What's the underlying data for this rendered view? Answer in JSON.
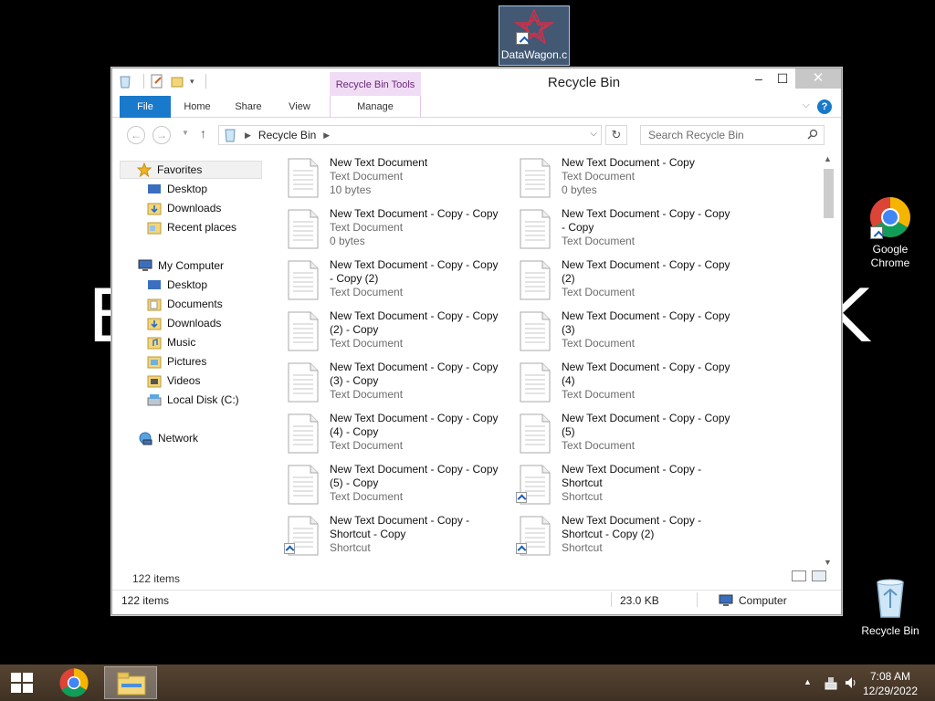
{
  "desktop": {
    "bg_text_left": "B",
    "bg_text_right": "K",
    "icons": [
      {
        "label": "DataWagon.c",
        "icon": "datawagon-icon"
      },
      {
        "label": "Google Chrome",
        "icon": "chrome-icon"
      },
      {
        "label": "Recycle Bin",
        "icon": "recycle-bin-icon"
      }
    ]
  },
  "window": {
    "title": "Recycle Bin",
    "context_tab": "Recycle Bin Tools",
    "ribbon_tabs": [
      "File",
      "Home",
      "Share",
      "View",
      "Manage"
    ],
    "help_label": "?",
    "address": {
      "root_label": "Recycle Bin"
    },
    "search": {
      "placeholder": "Search Recycle Bin"
    },
    "nav": {
      "favorites_label": "Favorites",
      "favorites": [
        "Desktop",
        "Downloads",
        "Recent places"
      ],
      "computer_label": "My Computer",
      "computer": [
        "Desktop",
        "Documents",
        "Downloads",
        "Music",
        "Pictures",
        "Videos",
        "Local Disk (C:)"
      ],
      "network_label": "Network"
    },
    "files": [
      {
        "line1": "New Text Document",
        "line2": "",
        "line3": "Text Document",
        "line4": "10 bytes",
        "shortcut": false
      },
      {
        "line1": "New Text Document - Copy",
        "line2": "",
        "line3": "Text Document",
        "line4": "0 bytes",
        "shortcut": false
      },
      {
        "line1": "New Text Document - Copy - Copy",
        "line2": "",
        "line3": "Text Document",
        "line4": "0 bytes",
        "shortcut": false
      },
      {
        "line1": "New Text Document - Copy - Copy",
        "line2": "- Copy",
        "line3": "Text Document",
        "line4": "",
        "shortcut": false
      },
      {
        "line1": "New Text Document - Copy - Copy",
        "line2": "- Copy (2)",
        "line3": "Text Document",
        "line4": "",
        "shortcut": false
      },
      {
        "line1": "New Text Document - Copy - Copy",
        "line2": "(2)",
        "line3": "Text Document",
        "line4": "",
        "shortcut": false
      },
      {
        "line1": "New Text Document - Copy - Copy",
        "line2": "(2) - Copy",
        "line3": "Text Document",
        "line4": "",
        "shortcut": false
      },
      {
        "line1": "New Text Document - Copy - Copy",
        "line2": "(3)",
        "line3": "Text Document",
        "line4": "",
        "shortcut": false
      },
      {
        "line1": "New Text Document - Copy - Copy",
        "line2": "(3) - Copy",
        "line3": "Text Document",
        "line4": "",
        "shortcut": false
      },
      {
        "line1": "New Text Document - Copy - Copy",
        "line2": "(4)",
        "line3": "Text Document",
        "line4": "",
        "shortcut": false
      },
      {
        "line1": "New Text Document - Copy - Copy",
        "line2": "(4) - Copy",
        "line3": "Text Document",
        "line4": "",
        "shortcut": false
      },
      {
        "line1": "New Text Document - Copy - Copy",
        "line2": "(5)",
        "line3": "Text Document",
        "line4": "",
        "shortcut": false
      },
      {
        "line1": "New Text Document - Copy - Copy",
        "line2": "(5) - Copy",
        "line3": "Text Document",
        "line4": "",
        "shortcut": false
      },
      {
        "line1": "New Text Document - Copy -",
        "line2": "Shortcut",
        "line3": "Shortcut",
        "line4": "",
        "shortcut": true
      },
      {
        "line1": "New Text Document - Copy -",
        "line2": "Shortcut - Copy",
        "line3": "Shortcut",
        "line4": "",
        "shortcut": true
      },
      {
        "line1": "New Text Document - Copy -",
        "line2": "Shortcut - Copy (2)",
        "line3": "Shortcut",
        "line4": "",
        "shortcut": true
      }
    ],
    "item_count": "122 items",
    "status": {
      "items": "122 items",
      "size": "23.0 KB",
      "location": "Computer"
    }
  },
  "taskbar": {
    "time": "7:08 AM",
    "date": "12/29/2022"
  },
  "colors": {
    "accent": "#1979ca",
    "context_tab_bg": "#f1dcf5",
    "taskbar": "#4a3a2a"
  }
}
